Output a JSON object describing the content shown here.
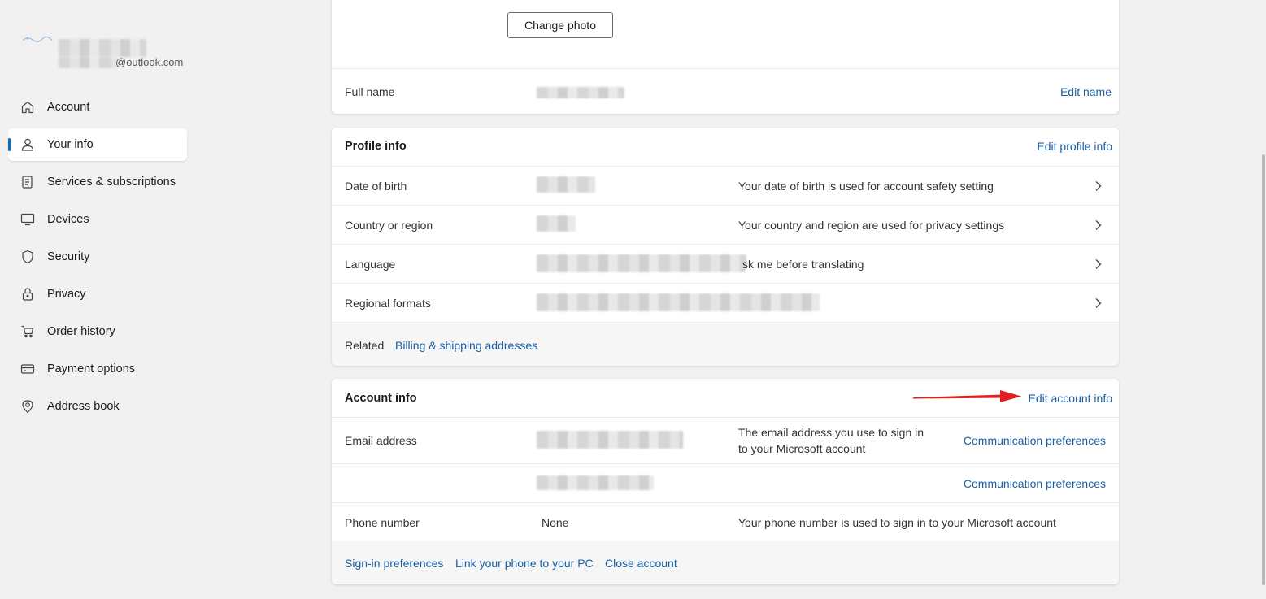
{
  "sidebar": {
    "email_suffix": "@outlook.com",
    "items": [
      {
        "label": "Account",
        "icon": "home-icon"
      },
      {
        "label": "Your info",
        "icon": "person-icon",
        "active": true
      },
      {
        "label": "Services & subscriptions",
        "icon": "receipt-icon"
      },
      {
        "label": "Devices",
        "icon": "monitor-icon"
      },
      {
        "label": "Security",
        "icon": "shield-icon"
      },
      {
        "label": "Privacy",
        "icon": "lock-icon"
      },
      {
        "label": "Order history",
        "icon": "cart-icon"
      },
      {
        "label": "Payment options",
        "icon": "card-icon"
      },
      {
        "label": "Address book",
        "icon": "location-icon"
      }
    ]
  },
  "photo_card": {
    "change_photo_label": "Change photo",
    "full_name_label": "Full name",
    "edit_name_label": "Edit name"
  },
  "profile_info": {
    "title": "Profile info",
    "edit_label": "Edit profile info",
    "rows": [
      {
        "label": "Date of birth",
        "desc": "Your date of birth is used for account safety setting"
      },
      {
        "label": "Country or region",
        "desc": "Your country and region are used for privacy settings"
      },
      {
        "label": "Language",
        "desc": "sk me before translating"
      },
      {
        "label": "Regional formats",
        "desc": ""
      }
    ],
    "related_label": "Related",
    "related_link": "Billing & shipping addresses"
  },
  "account_info": {
    "title": "Account info",
    "edit_label": "Edit account info",
    "email_label": "Email address",
    "email_desc_line1": "The email address you use to sign in",
    "email_desc_line2": "to your Microsoft account",
    "comm_pref_label": "Communication preferences",
    "phone_label": "Phone number",
    "phone_value": "None",
    "phone_desc": "Your phone number is used to sign in to your Microsoft account",
    "footer_links": [
      "Sign-in preferences",
      "Link your phone to your PC",
      "Close account"
    ]
  },
  "colors": {
    "accent": "#0f6cbd",
    "link": "#1a5fa3",
    "annotation_arrow": "#e02020"
  }
}
